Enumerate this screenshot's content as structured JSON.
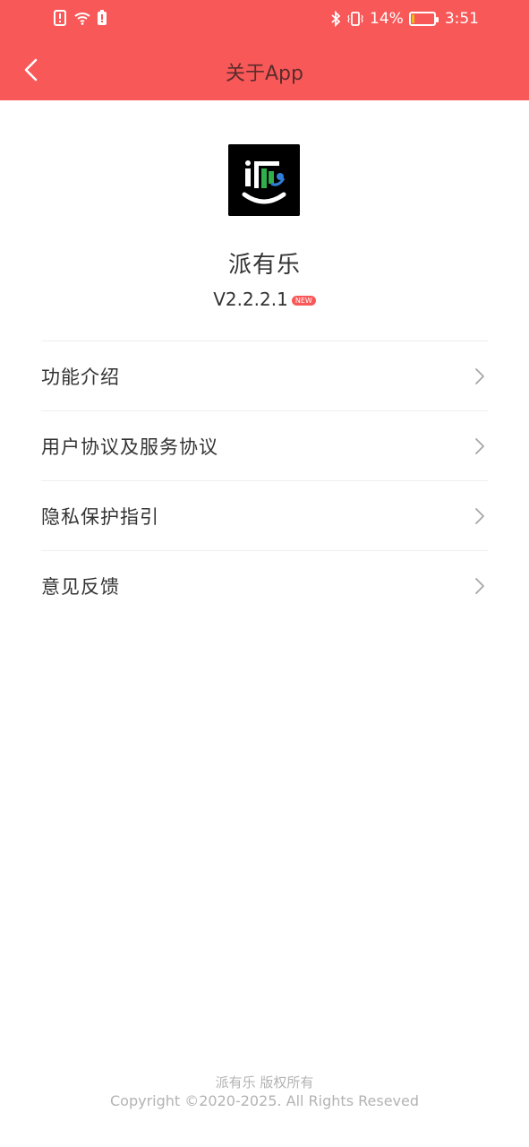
{
  "status_bar": {
    "left_icons": [
      "alert-icon",
      "wifi-icon",
      "battery-alert-icon"
    ],
    "right_icons": [
      "bluetooth-icon",
      "vibrate-icon"
    ],
    "battery_percent_text": "14%",
    "battery_level": 0.14,
    "time": "3:51",
    "colors": {
      "battery_fill": "#f2b51a"
    }
  },
  "header": {
    "title": "关于App",
    "back_icon": "chevron-left-icon",
    "background": "#f95858"
  },
  "app": {
    "name": "派有乐",
    "version": "V2.2.2.1",
    "badge": "NEW"
  },
  "menu": {
    "items": [
      {
        "label": "功能介绍",
        "icon": "chevron-right-icon"
      },
      {
        "label": "用户协议及服务协议",
        "icon": "chevron-right-icon"
      },
      {
        "label": "隐私保护指引",
        "icon": "chevron-right-icon"
      },
      {
        "label": "意见反馈",
        "icon": "chevron-right-icon"
      }
    ]
  },
  "footer": {
    "line1": "派有乐 版权所有",
    "line2": "Copyright ©2020-2025. All Rights Reseved"
  }
}
